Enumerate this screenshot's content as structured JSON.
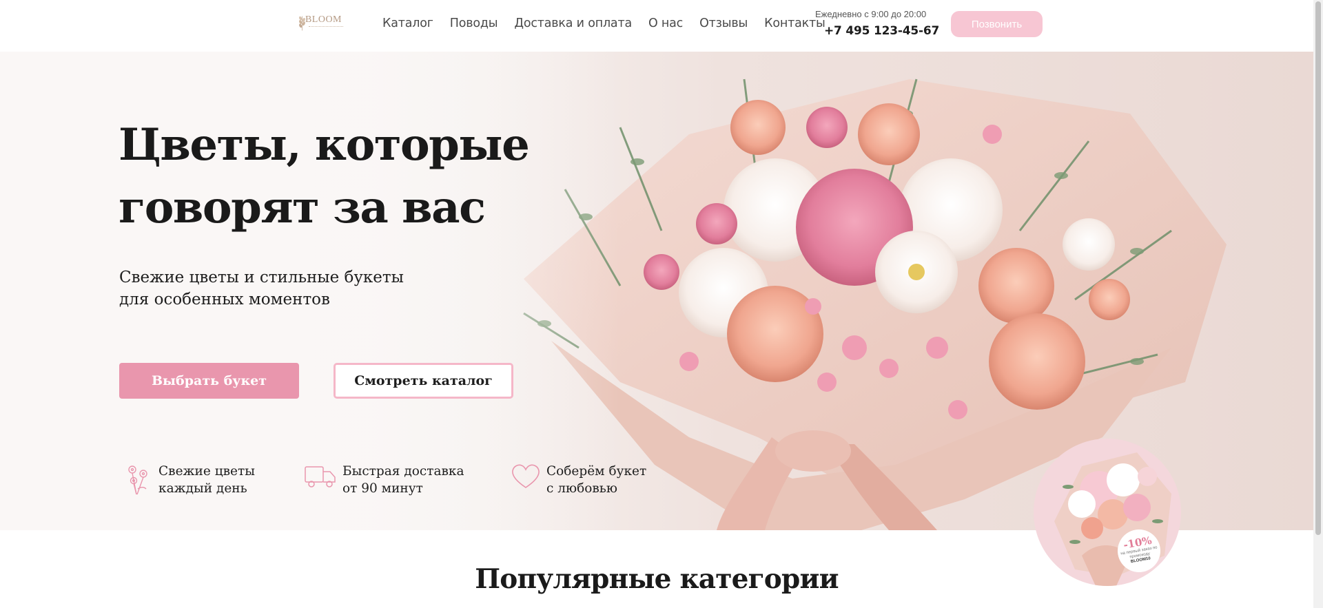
{
  "header": {
    "logo_text": "BLOOM",
    "nav": [
      "Каталог",
      "Поводы",
      "Доставка и оплата",
      "О нас",
      "Отзывы",
      "Контакты"
    ],
    "hours": "Ежедневно с 9:00 до 20:00",
    "phone": "+7 495 123-45-67",
    "call_button": "Позвонить"
  },
  "hero": {
    "title": "Цветы, которые говорят за вас",
    "subtitle_line1": "Свежие цветы и стильные букеты",
    "subtitle_line2": "для особенных моментов",
    "primary_button": "Выбрать букет",
    "secondary_button": "Смотреть каталог",
    "features": [
      {
        "icon": "flower-icon",
        "line1": "Свежие цветы",
        "line2": "каждый день"
      },
      {
        "icon": "truck-icon",
        "line1": "Быстрая доставка",
        "line2": "от 90 минут"
      },
      {
        "icon": "heart-icon",
        "line1": "Соберём букет",
        "line2": "с любовью"
      }
    ]
  },
  "promo": {
    "discount": "-10%",
    "note": "на первый заказ по промокоду",
    "code": "BLOOM10"
  },
  "section": {
    "title": "Популярные категории"
  },
  "colors": {
    "accent_pink": "#e996ad",
    "button_light_pink": "#f7c6d3",
    "outline_pink": "#f5b7c8",
    "text_dark": "#1a1a1a"
  }
}
